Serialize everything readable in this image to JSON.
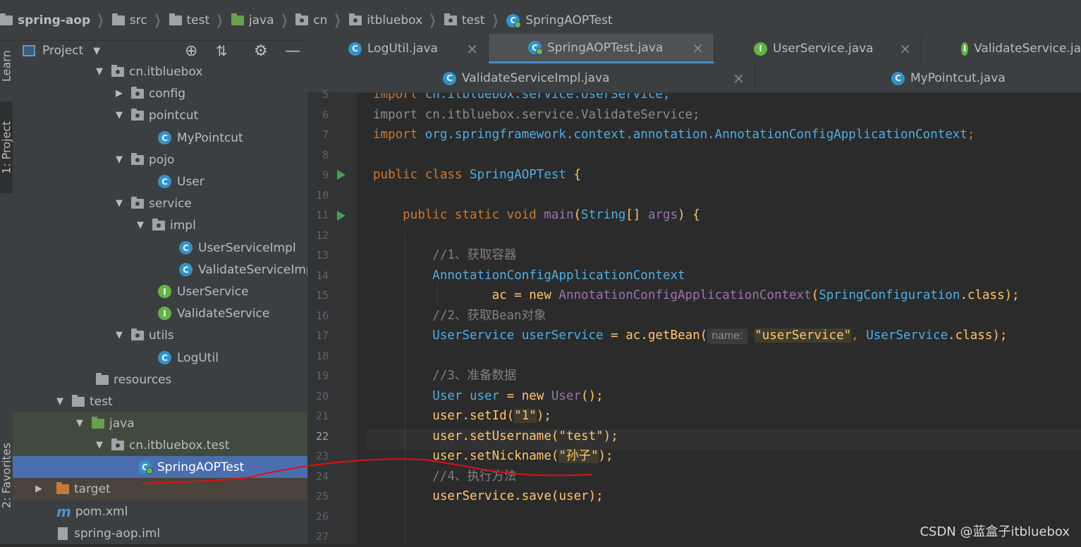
{
  "breadcrumb": [
    {
      "label": "spring-aop",
      "icon": "module-folder-icon"
    },
    {
      "label": "src",
      "icon": "folder-icon"
    },
    {
      "label": "test",
      "icon": "folder-icon"
    },
    {
      "label": "java",
      "icon": "test-source-folder-icon"
    },
    {
      "label": "cn",
      "icon": "package-icon"
    },
    {
      "label": "itbluebox",
      "icon": "package-icon"
    },
    {
      "label": "test",
      "icon": "package-icon"
    },
    {
      "label": "SpringAOPTest",
      "icon": "java-class-icon"
    }
  ],
  "sidebar_tabs": {
    "learn": "Learn",
    "project": "1: Project",
    "favorites": "2: Favorites"
  },
  "project_panel": {
    "title": "Project",
    "tree": [
      {
        "label": "cn.itbluebox",
        "type": "package",
        "expanded": true
      },
      {
        "label": "config",
        "type": "package",
        "expanded": false
      },
      {
        "label": "pointcut",
        "type": "package",
        "expanded": true
      },
      {
        "label": "MyPointcut",
        "type": "class"
      },
      {
        "label": "pojo",
        "type": "package",
        "expanded": true
      },
      {
        "label": "User",
        "type": "class"
      },
      {
        "label": "service",
        "type": "package",
        "expanded": true
      },
      {
        "label": "impl",
        "type": "package",
        "expanded": true
      },
      {
        "label": "UserServiceImpl",
        "type": "class"
      },
      {
        "label": "ValidateServiceImpl",
        "type": "class"
      },
      {
        "label": "UserService",
        "type": "interface"
      },
      {
        "label": "ValidateService",
        "type": "interface"
      },
      {
        "label": "utils",
        "type": "package",
        "expanded": true
      },
      {
        "label": "LogUtil",
        "type": "class"
      },
      {
        "label": "resources",
        "type": "resources"
      },
      {
        "label": "test",
        "type": "folder",
        "expanded": true
      },
      {
        "label": "java",
        "type": "test-source",
        "expanded": true
      },
      {
        "label": "cn.itbluebox.test",
        "type": "package",
        "expanded": true
      },
      {
        "label": "SpringAOPTest",
        "type": "class",
        "selected": true
      },
      {
        "label": "target",
        "type": "excluded",
        "expanded": false
      },
      {
        "label": "pom.xml",
        "type": "maven"
      },
      {
        "label": "spring-aop.iml",
        "type": "iml"
      }
    ]
  },
  "editor_tabs": {
    "row1": [
      {
        "label": "LogUtil.java",
        "type": "class"
      },
      {
        "label": "SpringAOPTest.java",
        "type": "class",
        "active": true
      },
      {
        "label": "UserService.java",
        "type": "interface"
      },
      {
        "label": "ValidateService.ja",
        "type": "interface"
      }
    ],
    "row2": [
      {
        "label": "ValidateServiceImpl.java",
        "type": "class"
      },
      {
        "label": "MyPointcut.java",
        "type": "class"
      }
    ]
  },
  "editor": {
    "line_numbers": [
      "5",
      "6",
      "7",
      "8",
      "9",
      "10",
      "11",
      "12",
      "13",
      "14",
      "15",
      "16",
      "17",
      "18",
      "19",
      "20",
      "21",
      "22",
      "23",
      "24",
      "25",
      "26",
      "27"
    ],
    "current_line": "22",
    "lines": {
      "l5_import": "import",
      "l5_rest": " cn.itbluebox.service.UserService;",
      "l6": "import cn.itbluebox.service.ValidateService;",
      "l7_import": "import",
      "l7_pkg": " org.springframework.context.annotation.AnnotationConfigApplicationContext",
      "l9_kw": "public class",
      "l9_name": " SpringAOPTest",
      "l9_brace": " {",
      "l11_kw": "public static void",
      "l11_name": " main",
      "l11_p1": "(",
      "l11_type": "String",
      "l11_arr": "[]",
      "l11_arg": " args",
      "l11_p2": ") {",
      "l13": "//1、获取容器",
      "l14": "AnnotationConfigApplicationContext",
      "l15_var": "ac",
      "l15_eq": " = ",
      "l15_new": "new",
      "l15_cls": " AnnotationConfigApplicationContext",
      "l15_p": "(",
      "l15_type": "SpringConfiguration",
      ".": ".",
      "l15_class": "class",
      "l15_end": ");",
      "l16": "//2、获取Bean对象",
      "l17_type": "UserService",
      "l17_var": " userService",
      "l17_eq": " = ",
      "l17_ac": "ac",
      "l17_get": ".getBean(",
      "l17_hint": "name:",
      "l17_str": "\"userService\"",
      "l17_comma": ", ",
      "l17_t2": "UserService",
      "l17_dot": ".",
      "l17_class": "class",
      "l17_end": ");",
      "l19": "//3、准备数据",
      "l20_type": "User",
      "l20_var": " user",
      "l20_eq": " = ",
      "l20_new": "new",
      "l20_cls": " User",
      "l20_end": "();",
      "l21_var": "user",
      "l21_m": ".setId",
      "l21_p": "(",
      "l21_str": "\"1\"",
      "l21_end": ");",
      "l22_var": "user",
      "l22_m": ".setUsername",
      "l22_p": "(",
      "l22_str": "\"test\"",
      "l22_end": ");",
      "l23_var": "user",
      "l23_m": ".setNickname",
      "l23_p": "(",
      "l23_str": "\"孙子\"",
      "l23_end": ");",
      "l24": "//4、执行方法",
      "l25_var": "userService",
      "l25_m": ".save",
      "l25_p": "(",
      "l25_arg": "user",
      "l25_end": ");"
    }
  },
  "watermark": "CSDN @蓝盒子itbluebox",
  "colors": {
    "annotation": "#e01010",
    "selection": "#4b6eaf",
    "tab_underline": "#4a88c7"
  }
}
